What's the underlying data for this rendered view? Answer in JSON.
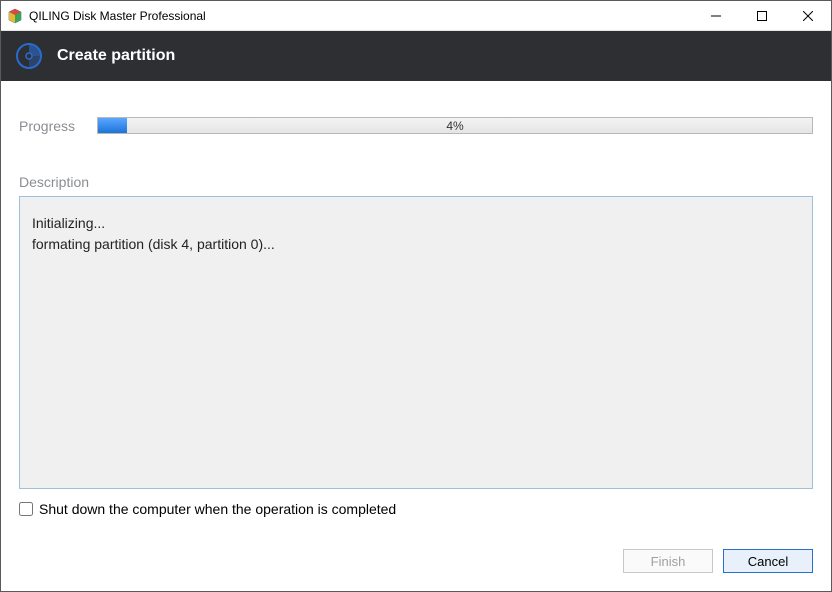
{
  "window": {
    "title": "QILING Disk Master Professional"
  },
  "header": {
    "operation_title": "Create partition"
  },
  "progress": {
    "label": "Progress",
    "percent": 4,
    "percent_text": "4%"
  },
  "description": {
    "label": "Description",
    "lines": [
      "Initializing...",
      "formating partition (disk 4, partition 0)..."
    ]
  },
  "shutdown": {
    "checked": false,
    "label": "Shut down the computer when the operation is completed"
  },
  "buttons": {
    "finish": "Finish",
    "cancel": "Cancel"
  }
}
